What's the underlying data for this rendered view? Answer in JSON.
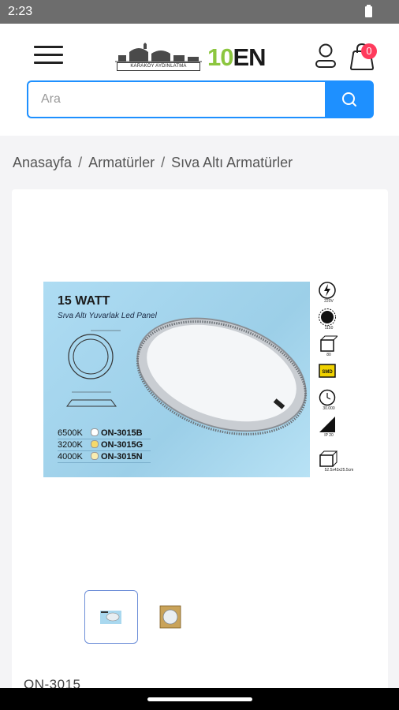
{
  "status_bar": {
    "time": "2:23"
  },
  "header": {
    "karakoy_logo_text": "KARAKÖY AYDINLATMA",
    "brand_ten": "10",
    "brand_en": "EN",
    "cart_count": "0"
  },
  "search": {
    "placeholder": "Ara"
  },
  "breadcrumb": {
    "items": [
      "Anasayfa",
      "Armatürler",
      "Sıva Altı Armatürler"
    ],
    "separator": "/"
  },
  "product": {
    "image": {
      "watt": "15 WATT",
      "subtitle": "Sıva Altı Yuvarlak Led Panel",
      "variants": [
        {
          "kelvin": "6500K",
          "code": "ON-3015B",
          "dot_color": "#ffffff"
        },
        {
          "kelvin": "3200K",
          "code": "ON-3015G",
          "dot_color": "#f5d96b"
        },
        {
          "kelvin": "4000K",
          "code": "ON-3015N",
          "dot_color": "#f8ecb0"
        }
      ],
      "icon_captions": [
        "220V",
        "1150",
        "80",
        "SMD",
        "30.000",
        "IP 20",
        "52.5x43x25.5cm"
      ]
    },
    "code": "ON-3015"
  },
  "colors": {
    "accent": "#1e90ff",
    "badge": "#ff3b5c",
    "brand_green": "#8cc63f"
  }
}
